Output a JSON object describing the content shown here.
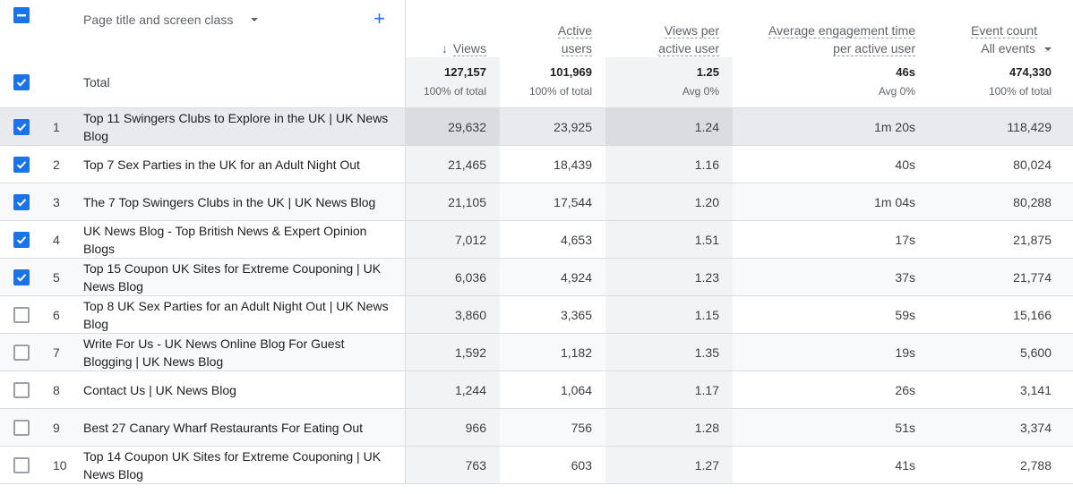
{
  "header": {
    "dimension_label": "Page title and screen class",
    "add_dimension_icon": "plus-icon",
    "select_all_state": "indeterminate",
    "columns": {
      "views": "Views",
      "active_users_line1": "Active",
      "active_users_line2": "users",
      "vpu_line1": "Views per",
      "vpu_line2": "active user",
      "eng_line1": "Average engagement time",
      "eng_line2": "per active user",
      "events": "Event count",
      "events_filter": "All events"
    },
    "sort_icon": "arrow-down-icon"
  },
  "total": {
    "label": "Total",
    "checked": true,
    "views": "127,157",
    "views_sub": "100% of total",
    "users": "101,969",
    "users_sub": "100% of total",
    "vpu": "1.25",
    "vpu_sub": "Avg 0%",
    "eng": "46s",
    "eng_sub": "Avg 0%",
    "events": "474,330",
    "events_sub": "100% of total"
  },
  "rows": [
    {
      "n": "1",
      "title": "Top 11 Swingers Clubs to Explore in the UK | UK News Blog",
      "views": "29,632",
      "users": "23,925",
      "vpu": "1.24",
      "eng": "1m 20s",
      "events": "118,429",
      "checked": true
    },
    {
      "n": "2",
      "title": "Top 7 Sex Parties in the UK for an Adult Night Out",
      "views": "21,465",
      "users": "18,439",
      "vpu": "1.16",
      "eng": "40s",
      "events": "80,024",
      "checked": true
    },
    {
      "n": "3",
      "title": "The 7 Top Swingers Clubs in the UK | UK News Blog",
      "views": "21,105",
      "users": "17,544",
      "vpu": "1.20",
      "eng": "1m 04s",
      "events": "80,288",
      "checked": true
    },
    {
      "n": "4",
      "title": "UK News Blog - Top British News & Expert Opinion Blogs",
      "views": "7,012",
      "users": "4,653",
      "vpu": "1.51",
      "eng": "17s",
      "events": "21,875",
      "checked": true
    },
    {
      "n": "5",
      "title": "Top 15 Coupon UK Sites for Extreme Couponing | UK News Blog",
      "views": "6,036",
      "users": "4,924",
      "vpu": "1.23",
      "eng": "37s",
      "events": "21,774",
      "checked": true
    },
    {
      "n": "6",
      "title": "Top 8 UK Sex Parties for an Adult Night Out | UK News Blog",
      "views": "3,860",
      "users": "3,365",
      "vpu": "1.15",
      "eng": "59s",
      "events": "15,166",
      "checked": false
    },
    {
      "n": "7",
      "title": "Write For Us - UK News Online Blog For Guest Blogging | UK News Blog",
      "views": "1,592",
      "users": "1,182",
      "vpu": "1.35",
      "eng": "19s",
      "events": "5,600",
      "checked": false
    },
    {
      "n": "8",
      "title": "Contact Us | UK News Blog",
      "views": "1,244",
      "users": "1,064",
      "vpu": "1.17",
      "eng": "26s",
      "events": "3,141",
      "checked": false
    },
    {
      "n": "9",
      "title": "Best 27 Canary Wharf Restaurants For Eating Out",
      "views": "966",
      "users": "756",
      "vpu": "1.28",
      "eng": "51s",
      "events": "3,374",
      "checked": false
    },
    {
      "n": "10",
      "title": "Top 14 Coupon UK Sites for Extreme Couponing | UK News Blog",
      "views": "763",
      "users": "603",
      "vpu": "1.27",
      "eng": "41s",
      "events": "2,788",
      "checked": false
    }
  ],
  "colors": {
    "accent": "#1a73e8",
    "hover_row": "#e8eaed",
    "alt_row": "#f8f9fa",
    "shaded_col": "#f1f3f4",
    "border": "#dadce0"
  }
}
